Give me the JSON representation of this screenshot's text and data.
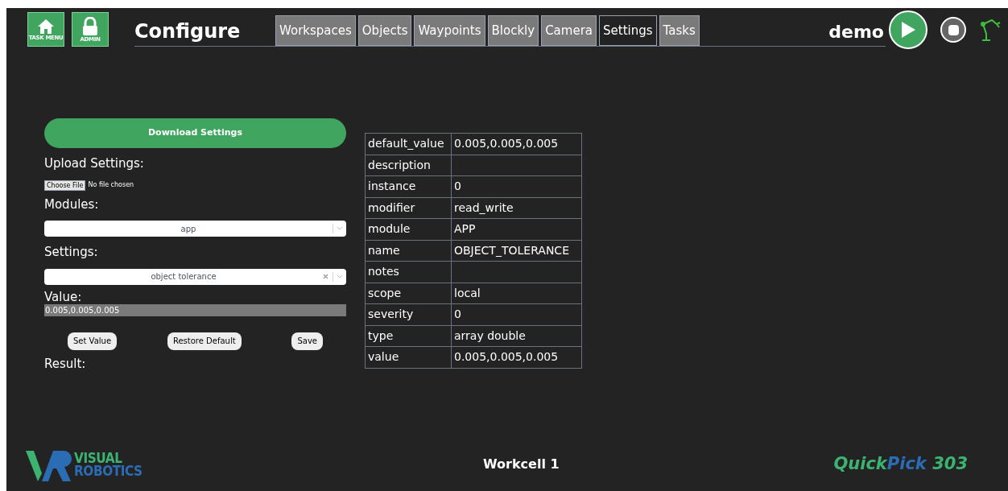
{
  "header": {
    "nav_buttons": [
      {
        "label": "TASK MENU",
        "kind": "home"
      },
      {
        "label": "ADMIN",
        "kind": "lock"
      }
    ],
    "title": "Configure",
    "tabs": [
      {
        "label": "Workspaces",
        "selected": false
      },
      {
        "label": "Objects",
        "selected": false
      },
      {
        "label": "Waypoints",
        "selected": false
      },
      {
        "label": "Blockly",
        "selected": false
      },
      {
        "label": "Camera",
        "selected": false
      },
      {
        "label": "Settings",
        "selected": true
      },
      {
        "label": "Tasks",
        "selected": false
      }
    ],
    "user": "demo"
  },
  "settings_panel": {
    "download_button": "Download Settings",
    "upload_label": "Upload Settings:",
    "file_button": "Choose File",
    "file_status": "No file chosen",
    "modules_label": "Modules:",
    "modules_select": {
      "value": "app",
      "clearable": false
    },
    "settings_label": "Settings:",
    "settings_select": {
      "value": "object tolerance",
      "clearable": true
    },
    "value_label": "Value:",
    "value_field": "0.005,0.005,0.005",
    "buttons": [
      "Set Value",
      "Restore Default",
      "Save"
    ],
    "result_label": "Result:"
  },
  "details_table": [
    {
      "key": "default_value",
      "value": "0.005,0.005,0.005"
    },
    {
      "key": "description"
    },
    {
      "key": "instance",
      "value": "0"
    },
    {
      "key": "modifier",
      "value": "read_write"
    },
    {
      "key": "module",
      "value": "APP"
    },
    {
      "key": "name",
      "value": "OBJECT_TOLERANCE"
    },
    {
      "key": "notes"
    },
    {
      "key": "scope",
      "value": "local"
    },
    {
      "key": "severity",
      "value": "0"
    },
    {
      "key": "type",
      "value": "array double"
    },
    {
      "key": "value",
      "value": "0.005,0.005,0.005"
    }
  ],
  "footer": {
    "logo_lines": [
      "VISUAL",
      "ROBOTICS"
    ],
    "workcell": "Workcell 1",
    "product": [
      {
        "text": "Quick",
        "color": "#3cb371"
      },
      {
        "text": "Pick",
        "color": "#2a6db5"
      },
      {
        "text": " 303",
        "color": "#3cb371"
      }
    ]
  }
}
